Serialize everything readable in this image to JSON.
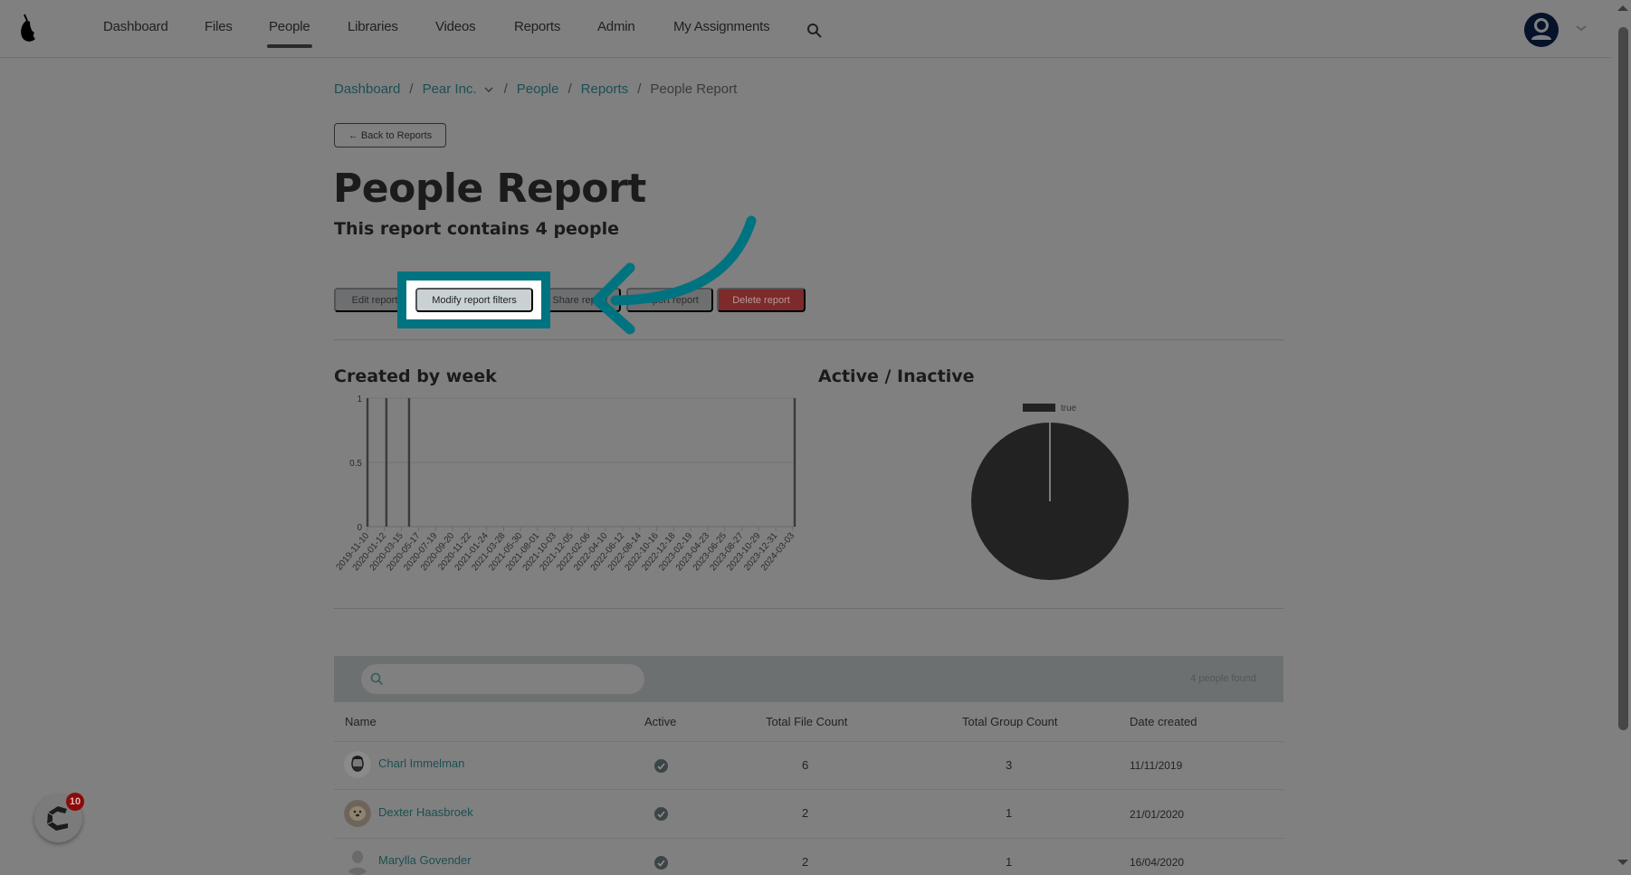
{
  "nav": {
    "logo": "pear-logo",
    "items": [
      {
        "label": "Dashboard",
        "active": false
      },
      {
        "label": "Files",
        "active": false
      },
      {
        "label": "People",
        "active": true
      },
      {
        "label": "Libraries",
        "active": false
      },
      {
        "label": "Videos",
        "active": false
      },
      {
        "label": "Reports",
        "active": false
      },
      {
        "label": "Admin",
        "active": false
      },
      {
        "label": "My Assignments",
        "active": false
      }
    ],
    "search_icon": "search-icon",
    "user_icon": "user-avatar-icon",
    "user_menu_icon": "chevron-down-icon"
  },
  "breadcrumb": {
    "items": [
      "Dashboard",
      "Pear Inc.",
      "People",
      "Reports"
    ],
    "current": "People Report",
    "separator": "/"
  },
  "back_button": "← Back to Reports",
  "page": {
    "title": "People Report",
    "subtitle": "This report contains 4 people"
  },
  "actions": {
    "edit": "Edit report",
    "modify": "Modify report filters",
    "share": "Share report",
    "export": "Export report",
    "delete": "Delete report"
  },
  "annotation": {
    "highlight_target": "Modify report filters",
    "color": "#007380"
  },
  "charts": {
    "created_title": "Created by week",
    "active_title": "Active / Inactive"
  },
  "chart_data": [
    {
      "type": "bar",
      "title": "Created by week",
      "xlabel": "",
      "ylabel": "",
      "ylim": [
        0,
        1
      ],
      "yticks": [
        "0",
        "0.5",
        "1"
      ],
      "grid": true,
      "x_tick_labels": [
        "2019-11-10",
        "2020-01-12",
        "2020-03-15",
        "2020-05-17",
        "2020-07-19",
        "2020-09-20",
        "2020-11-22",
        "2021-01-24",
        "2021-03-28",
        "2021-05-30",
        "2021-08-01",
        "2021-10-03",
        "2021-12-05",
        "2022-02-06",
        "2022-04-10",
        "2022-06-12",
        "2022-08-14",
        "2022-10-16",
        "2022-12-18",
        "2023-02-19",
        "2023-04-23",
        "2023-06-25",
        "2023-08-27",
        "2023-10-29",
        "2023-12-31",
        "2024-03-03"
      ],
      "x_range": [
        "2019-11-10",
        "2024-03-10"
      ],
      "bars": [
        {
          "week": "2019-11-10",
          "value": 1
        },
        {
          "week": "2020-01-19",
          "value": 1
        },
        {
          "week": "2020-04-12",
          "value": 1
        },
        {
          "week": "2024-03-10",
          "value": 1
        }
      ],
      "color": "#3a3a3a"
    },
    {
      "type": "pie",
      "title": "Active / Inactive",
      "legend": [
        "true"
      ],
      "legend_position": "top",
      "slices": [
        {
          "label": "true",
          "value": 4
        }
      ],
      "color": "#222222"
    }
  ],
  "table": {
    "search_placeholder": "",
    "found_text": "4 people found",
    "columns": [
      "Name",
      "Active",
      "Total File Count",
      "Total Group Count",
      "Date created"
    ],
    "rows": [
      {
        "name": "Charl Immelman",
        "avatar": "photo-man",
        "active": true,
        "files": "6",
        "groups": "3",
        "created": "11/11/2019"
      },
      {
        "name": "Dexter Haasbroek",
        "avatar": "photo-dog",
        "active": true,
        "files": "2",
        "groups": "1",
        "created": "21/01/2020"
      },
      {
        "name": "Marylla Govender",
        "avatar": "default-silhouette",
        "active": true,
        "files": "2",
        "groups": "1",
        "created": "16/04/2020"
      }
    ]
  },
  "widget": {
    "badge": "10",
    "icon": "chat-c-logo-icon"
  }
}
